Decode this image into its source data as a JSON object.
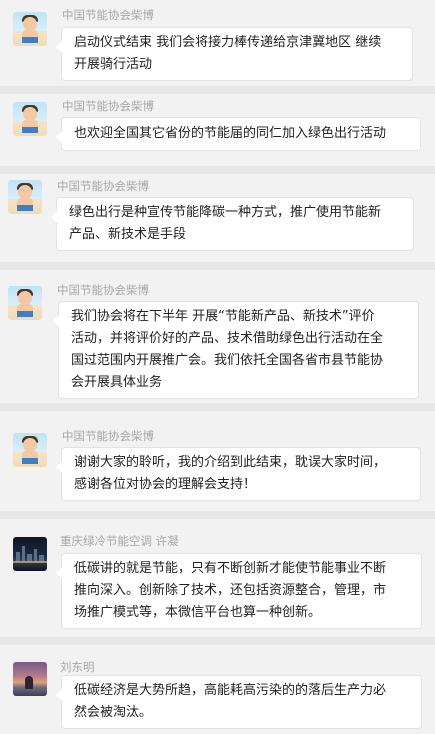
{
  "messages": [
    {
      "sender": "中国节能协会柴博",
      "avatar": "child-avatar",
      "lines": [
        "启动仪式结束 我们会将接力棒传递给京津冀地区 继续",
        "开展骑行活动"
      ]
    },
    {
      "sender": "中国节能协会柴博",
      "avatar": "child-avatar",
      "lines": [
        "也欢迎全国其它省份的节能届的同仁加入绿色出行活动"
      ]
    },
    {
      "sender": "中国节能协会柴博",
      "avatar": "child-avatar",
      "lines": [
        "绿色出行是种宣传节能降碳一种方式，推广使用节能新",
        "产品、新技术是手段"
      ]
    },
    {
      "sender": "中国节能协会柴博",
      "avatar": "child-avatar",
      "lines": [
        "我们协会将在下半年 开展“节能新产品、新技术”评价",
        "活动，并将评价好的产品、技术借助绿色出行活动在全",
        "国过范围内开展推广会。我们依托全国各省市县节能协",
        "会开展具体业务"
      ]
    },
    {
      "sender": "中国节能协会柴博",
      "avatar": "child-avatar",
      "lines": [
        "谢谢大家的聆听，我的介绍到此结束，耽误大家时间，",
        "感谢各位对协会的理解会支持！"
      ]
    },
    {
      "sender": "重庆绿冷节能空调 许凝",
      "avatar": "city-night-avatar",
      "lines": [
        "低碳讲的就是节能，只有不断创新才能使节能事业不断",
        "推向深入。创新除了技术，还包括资源整合，管理，市",
        "场推广模式等，本微信平台也算一种创新。"
      ]
    },
    {
      "sender": "刘东明",
      "avatar": "sunset-avatar",
      "lines": [
        "低碳经济是大势所趋，高能耗高污染的的落后生产力必",
        "然会被淘汰。"
      ]
    }
  ]
}
